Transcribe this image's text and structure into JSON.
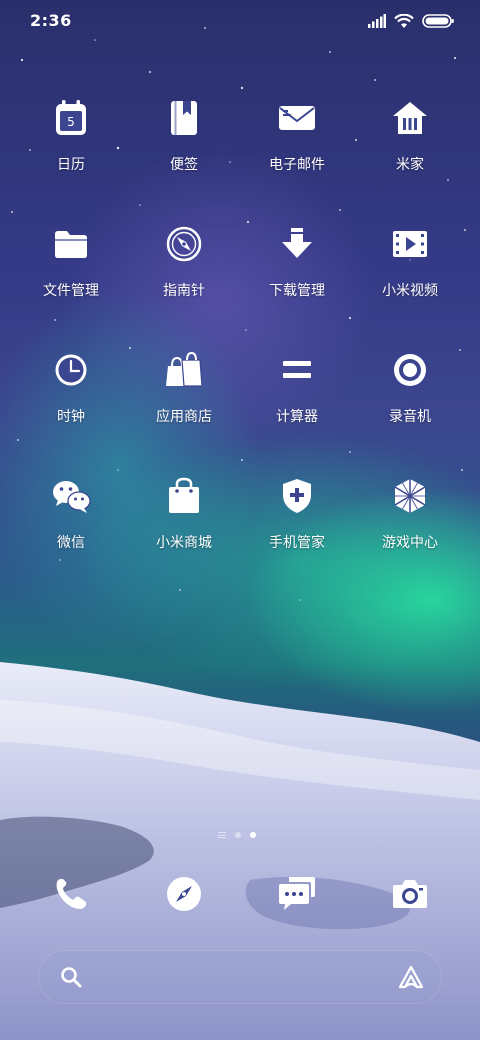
{
  "status_bar": {
    "time": "2:36",
    "icons": [
      "signal-icon",
      "wifi-icon",
      "battery-icon"
    ]
  },
  "apps": [
    {
      "label": "日历",
      "icon": "calendar-icon",
      "badge": "5"
    },
    {
      "label": "便签",
      "icon": "notes-icon"
    },
    {
      "label": "电子邮件",
      "icon": "email-icon"
    },
    {
      "label": "米家",
      "icon": "mijia-home-icon"
    },
    {
      "label": "文件管理",
      "icon": "folder-icon"
    },
    {
      "label": "指南针",
      "icon": "compass-icon"
    },
    {
      "label": "下载管理",
      "icon": "download-icon"
    },
    {
      "label": "小米视频",
      "icon": "video-icon"
    },
    {
      "label": "时钟",
      "icon": "clock-icon"
    },
    {
      "label": "应用商店",
      "icon": "app-store-icon"
    },
    {
      "label": "计算器",
      "icon": "calculator-icon"
    },
    {
      "label": "录音机",
      "icon": "recorder-icon"
    },
    {
      "label": "微信",
      "icon": "wechat-icon"
    },
    {
      "label": "小米商城",
      "icon": "mi-store-icon"
    },
    {
      "label": "手机管家",
      "icon": "security-shield-icon"
    },
    {
      "label": "游戏中心",
      "icon": "game-center-icon"
    }
  ],
  "page_indicator": {
    "pages": 3,
    "current": 3
  },
  "dock": [
    "phone-icon",
    "browser-compass-icon",
    "messages-icon",
    "camera-icon"
  ],
  "search_bar": {
    "icons": [
      "search-icon",
      "ai-assistant-icon"
    ]
  }
}
